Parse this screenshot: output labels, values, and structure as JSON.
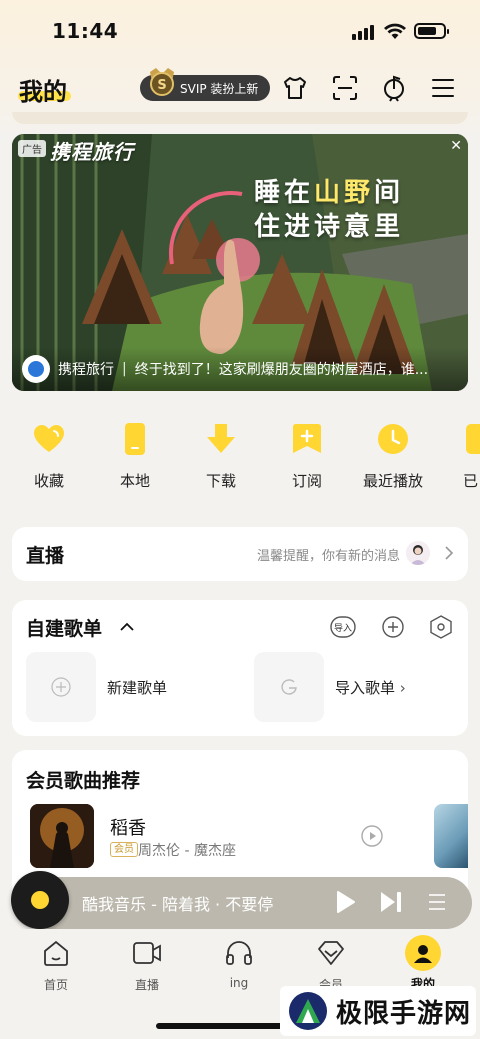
{
  "status_bar": {
    "time": "11:44"
  },
  "header": {
    "title": "我的",
    "svip_label": "SVIP 装扮上新",
    "svip_badge_letter": "S"
  },
  "ad": {
    "tag": "广告",
    "brand": "携程旅行",
    "slogan_line1_a": "睡在",
    "slogan_line1_b": "山野",
    "slogan_line1_c": "间",
    "slogan_line2": "住进诗意里",
    "source": "携程旅行",
    "separator": "|",
    "caption": "终于找到了！这家刷爆朋友圈的树屋酒店，谁..."
  },
  "quick_actions": [
    {
      "label": "收藏",
      "icon": "heart-icon"
    },
    {
      "label": "本地",
      "icon": "phone-icon"
    },
    {
      "label": "下载",
      "icon": "download-icon"
    },
    {
      "label": "订阅",
      "icon": "subscribe-icon"
    },
    {
      "label": "最近播放",
      "icon": "clock-icon"
    },
    {
      "label": "已",
      "icon": "purchased-icon"
    }
  ],
  "live": {
    "title": "直播",
    "message": "温馨提醒，你有新的消息"
  },
  "playlists": {
    "title": "自建歌单",
    "import_icon_label": "导入",
    "new_label": "新建歌单",
    "import_label": "导入歌单"
  },
  "vip_songs": {
    "title": "会员歌曲推荐",
    "song_name": "稻香",
    "tag": "会员",
    "artist": "周杰伦 - 魔杰座"
  },
  "mini_player": {
    "text": "酷我音乐 - 陪着我 · 不要停"
  },
  "tabs": [
    {
      "label": "首页",
      "icon": "home-icon"
    },
    {
      "label": "直播",
      "icon": "video-icon"
    },
    {
      "label": "ing",
      "icon": "headphones-icon"
    },
    {
      "label": "会员",
      "icon": "diamond-icon"
    },
    {
      "label": "我的",
      "icon": "profile-icon"
    }
  ],
  "watermark": {
    "text": "极限手游网"
  },
  "colors": {
    "accent": "#ffd632",
    "background": "#f4f2ef"
  }
}
